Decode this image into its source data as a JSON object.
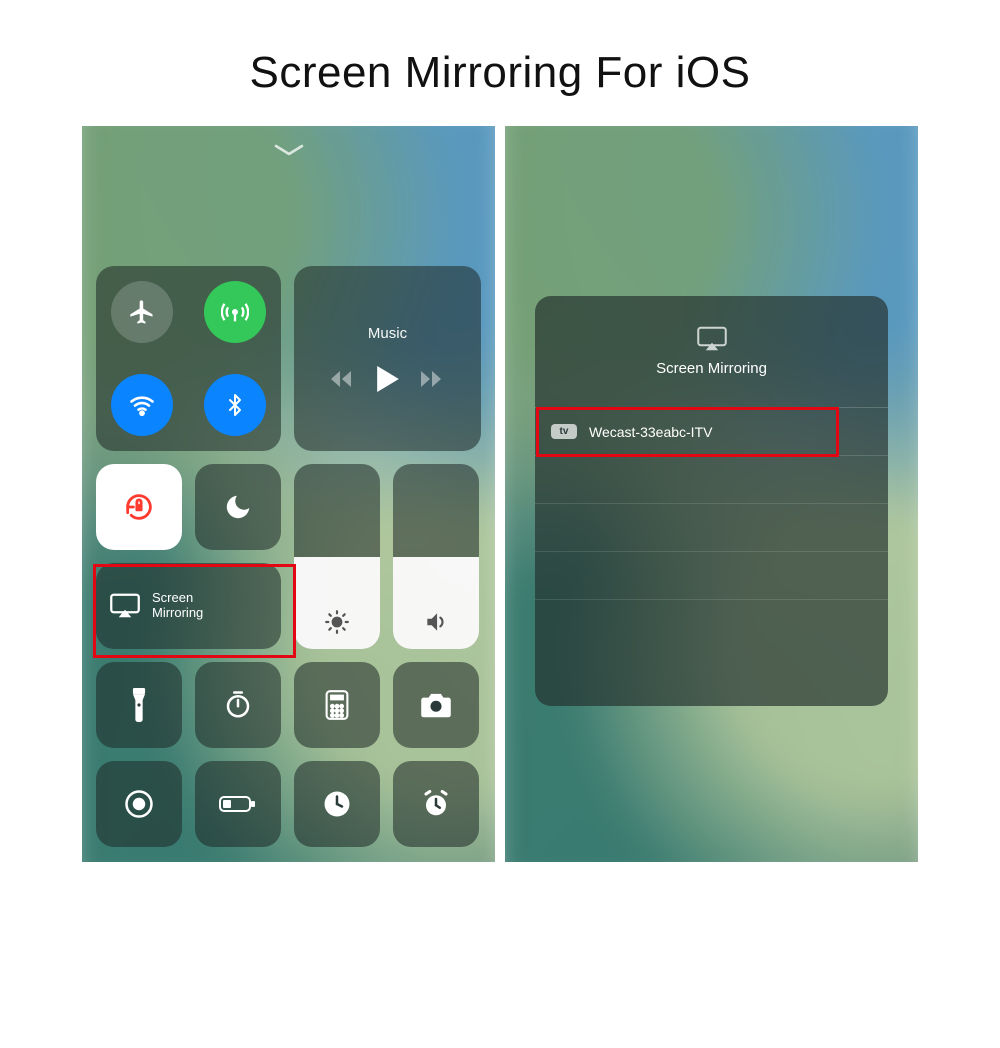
{
  "title": "Screen Mirroring For iOS",
  "left": {
    "music_label": "Music",
    "mirroring_line1": "Screen",
    "mirroring_line2": "Mirroring",
    "brightness_level": 50,
    "volume_level": 50,
    "toggles": {
      "airplane": false,
      "cellular": true,
      "wifi": true,
      "bluetooth": true,
      "orientation_lock": true,
      "do_not_disturb": false
    }
  },
  "right": {
    "card_title": "Screen Mirroring",
    "device_badge": "tv",
    "device_name": "Wecast-33eabc-ITV"
  },
  "colors": {
    "highlight": "#e30613",
    "active_blue": "#0a84ff",
    "active_green": "#34c759"
  }
}
